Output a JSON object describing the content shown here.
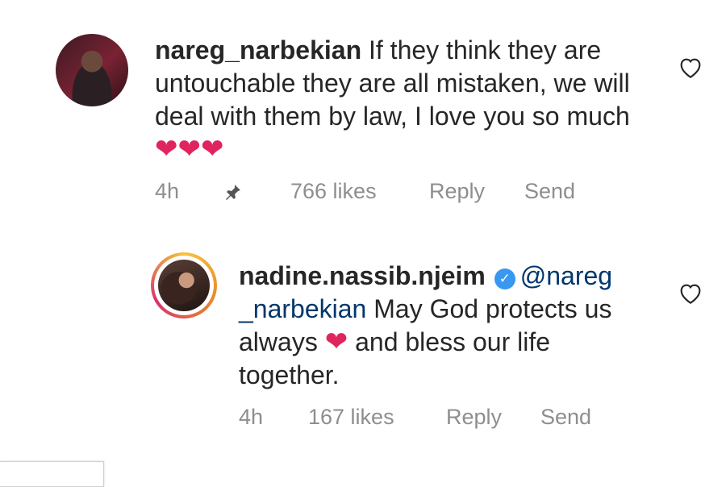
{
  "comments": [
    {
      "username": "nareg_narbekian",
      "text": "If they think they are untouchable they are all mistaken, we will deal with them by law, I love you so much",
      "emoji": "❤❤❤",
      "time": "4h",
      "likes": "766 likes",
      "reply_label": "Reply",
      "send_label": "Send",
      "pinned": true
    },
    {
      "username": "nadine.nassib.njeim",
      "verified": true,
      "mention": "@nareg _narbekian",
      "text_before_emoji": "May God protects us  always",
      "emoji": "❤",
      "text_after_emoji": "and bless our life together.",
      "time": "4h",
      "likes": "167 likes",
      "reply_label": "Reply",
      "send_label": "Send"
    }
  ],
  "icons": {
    "like": "heart-outline-icon",
    "pin": "pin-icon",
    "verified": "verified-badge-icon"
  },
  "colors": {
    "text": "#262626",
    "meta": "#8e8e8e",
    "mention": "#00376b",
    "heart": "#e0245e",
    "verified": "#3897f0"
  }
}
